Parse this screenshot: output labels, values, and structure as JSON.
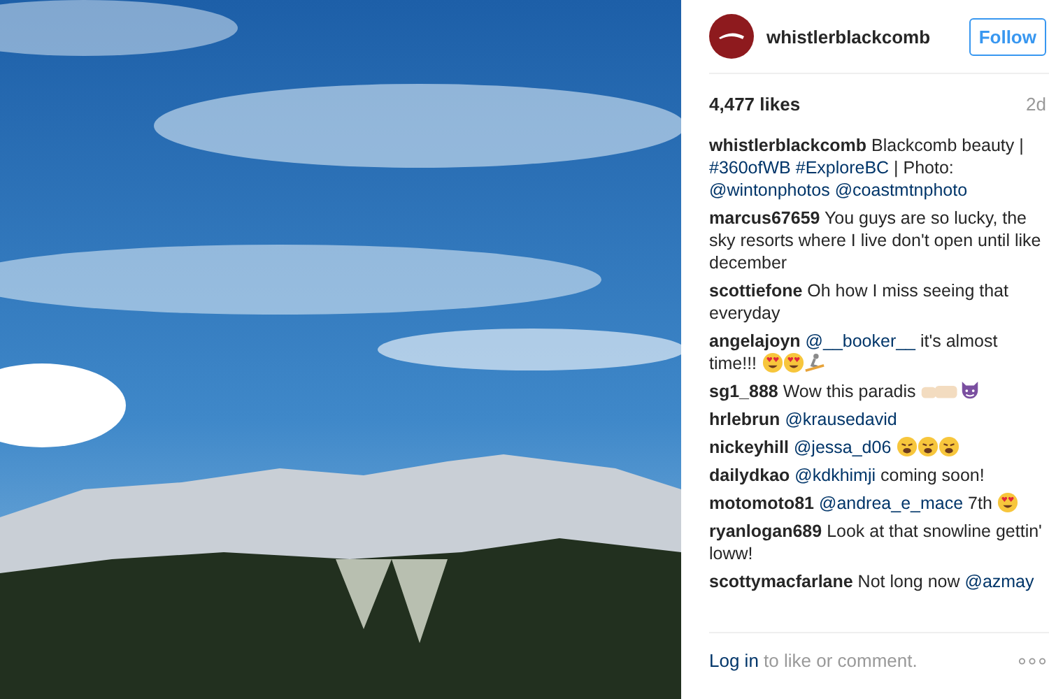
{
  "post": {
    "username": "whistlerblackcomb",
    "follow_label": "Follow",
    "likes": "4,477 likes",
    "age": "2d"
  },
  "comments": [
    {
      "parts": [
        {
          "kind": "user",
          "text": "whistlerblackcomb"
        },
        {
          "kind": "text",
          "text": " Blackcomb beauty | "
        },
        {
          "kind": "mention",
          "text": "#360ofWB"
        },
        {
          "kind": "mention",
          "text": "#ExploreBC",
          "space": true
        },
        {
          "kind": "text",
          "text": " | Photo: "
        },
        {
          "kind": "mention",
          "text": "@wintonphotos"
        },
        {
          "kind": "mention",
          "text": "@coastmtnphoto",
          "space": true
        }
      ]
    },
    {
      "parts": [
        {
          "kind": "user",
          "text": "marcus67659"
        },
        {
          "kind": "text",
          "text": " You guys are so lucky, the sky resorts where I live don't open until like december"
        }
      ]
    },
    {
      "parts": [
        {
          "kind": "user",
          "text": "scottiefone"
        },
        {
          "kind": "text",
          "text": " Oh how I miss seeing that everyday"
        }
      ]
    },
    {
      "parts": [
        {
          "kind": "user",
          "text": "angelajoyn"
        },
        {
          "kind": "mention",
          "text": "@__booker__",
          "space": true
        },
        {
          "kind": "text",
          "text": " it's almost time!!! "
        },
        {
          "kind": "hearteyes"
        },
        {
          "kind": "hearteyes"
        },
        {
          "kind": "snowboarder"
        }
      ]
    },
    {
      "parts": [
        {
          "kind": "user",
          "text": "sg1_888"
        },
        {
          "kind": "text",
          "text": " Wow this paradis "
        },
        {
          "kind": "fist"
        },
        {
          "kind": "devil"
        }
      ]
    },
    {
      "parts": [
        {
          "kind": "user",
          "text": "hrlebrun"
        },
        {
          "kind": "mention",
          "text": "@krausedavid",
          "space": true
        }
      ]
    },
    {
      "parts": [
        {
          "kind": "user",
          "text": "nickeyhill"
        },
        {
          "kind": "mention",
          "text": "@jessa_d06",
          "space": true
        },
        {
          "kind": "weary",
          "space": true
        },
        {
          "kind": "weary"
        },
        {
          "kind": "weary"
        }
      ]
    },
    {
      "parts": [
        {
          "kind": "user",
          "text": "dailydkao"
        },
        {
          "kind": "mention",
          "text": "@kdkhimji",
          "space": true
        },
        {
          "kind": "text",
          "text": " coming soon!"
        }
      ]
    },
    {
      "parts": [
        {
          "kind": "user",
          "text": "motomoto81"
        },
        {
          "kind": "mention",
          "text": "@andrea_e_mace",
          "space": true
        },
        {
          "kind": "text",
          "text": " 7th "
        },
        {
          "kind": "hearteyes"
        }
      ]
    },
    {
      "parts": [
        {
          "kind": "user",
          "text": "ryanlogan689"
        },
        {
          "kind": "text",
          "text": " Look at that snowline gettin' loww!"
        }
      ]
    },
    {
      "parts": [
        {
          "kind": "user",
          "text": "scottymacfarlane"
        },
        {
          "kind": "text",
          "text": " Not long now "
        },
        {
          "kind": "mention",
          "text": "@azmay"
        }
      ]
    }
  ],
  "footer": {
    "login_link": "Log in",
    "prompt": " to like or comment."
  }
}
